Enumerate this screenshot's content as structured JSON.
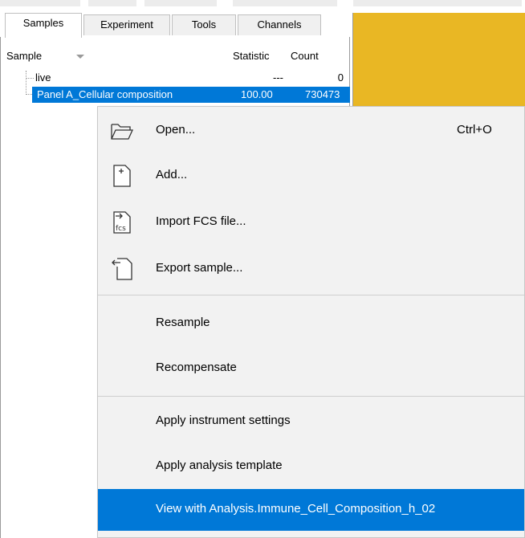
{
  "tabs": [
    {
      "label": "Samples",
      "active": true
    },
    {
      "label": "Experiment",
      "active": false
    },
    {
      "label": "Tools",
      "active": false
    },
    {
      "label": "Channels",
      "active": false
    }
  ],
  "table": {
    "columns": {
      "sample": "Sample",
      "statistic": "Statistic",
      "count": "Count"
    },
    "rows": [
      {
        "name": "live",
        "statistic": "---",
        "count": "0",
        "selected": false
      },
      {
        "name": "Panel A_Cellular composition",
        "statistic": "100.00",
        "count": "730473",
        "selected": true
      }
    ]
  },
  "context_menu": {
    "items": [
      {
        "label": "Open...",
        "shortcut": "Ctrl+O",
        "icon": "folder-open-icon"
      },
      {
        "label": "Add...",
        "icon": "add-document-icon"
      },
      {
        "label": "Import FCS file...",
        "icon": "import-fcs-icon"
      },
      {
        "label": "Export sample...",
        "icon": "export-icon"
      },
      {
        "label": "Resample"
      },
      {
        "label": "Recompensate"
      },
      {
        "label": "Apply instrument settings"
      },
      {
        "label": "Apply analysis template"
      },
      {
        "label": "View with Analysis.Immune_Cell_Composition_h_02",
        "highlighted": true
      }
    ],
    "fcs_icon_text": "fcs"
  },
  "colors": {
    "selection": "#0078d7",
    "accent_yellow": "#e9b724",
    "menu_bg": "#f2f2f2"
  }
}
